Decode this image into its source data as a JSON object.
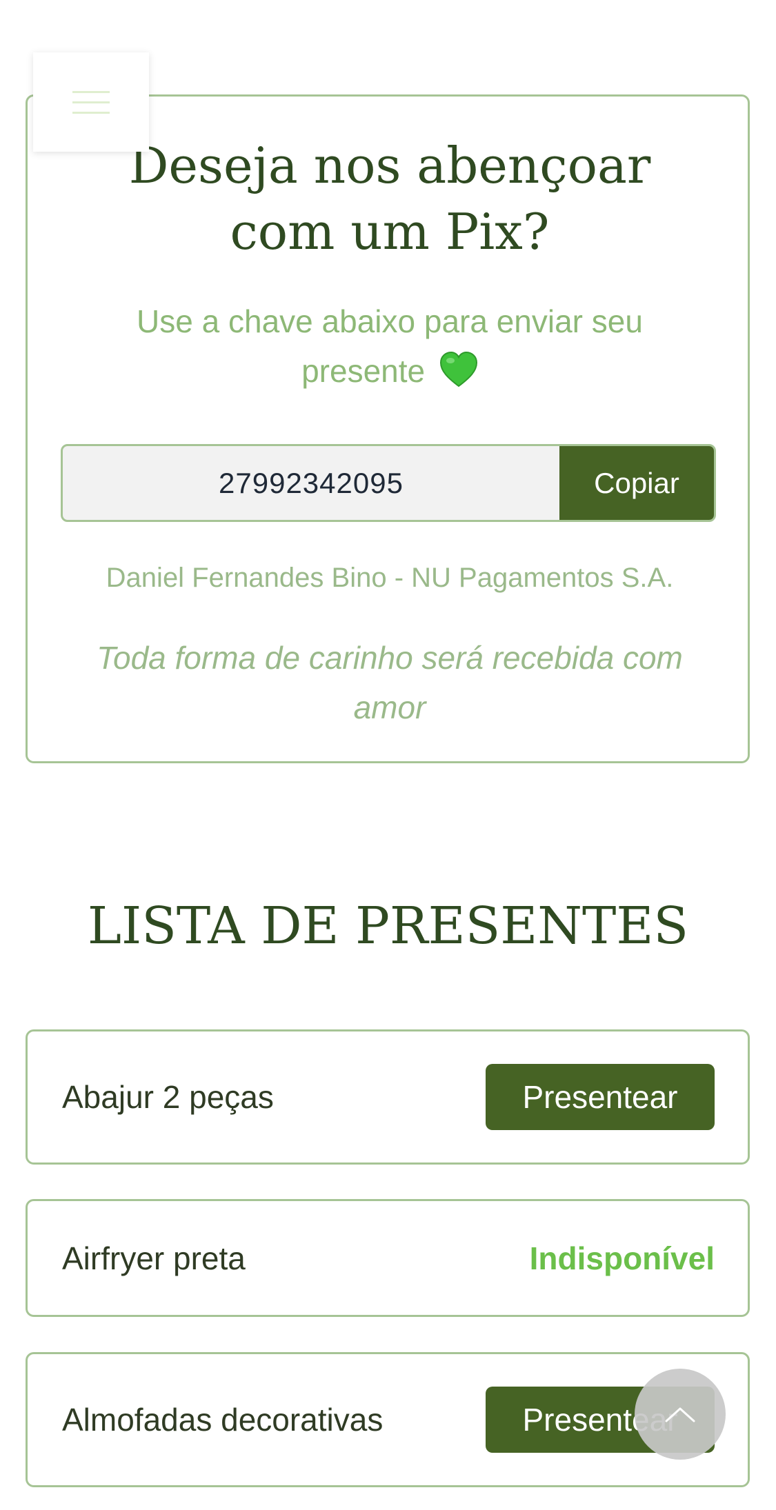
{
  "menu": {
    "icon": "hamburger-icon"
  },
  "pix": {
    "title": "Deseja nos abençoar com um Pix?",
    "subtitle": "Use a chave abaixo para enviar seu presente",
    "subtitle_icon": "green-heart-icon",
    "key_value": "27992342095",
    "copy_label": "Copiar",
    "account_info": "Daniel Fernandes Bino - NU Pagamentos S.A.",
    "note": "Toda forma de carinho será recebida com amor"
  },
  "gifts": {
    "title": "LISTA DE PRESENTES",
    "items": [
      {
        "name": "Abajur 2 peças",
        "action_label": "Presentear"
      },
      {
        "name": "Airfryer preta",
        "status_label": "Indisponível"
      },
      {
        "name": "Almofadas decorativas",
        "action_label": "Presentear"
      }
    ]
  },
  "scroll_top": {
    "icon": "chevron-up-icon"
  },
  "colors": {
    "primary_dark": "#466324",
    "heading": "#2f4a21",
    "accent_light": "#a6c495",
    "muted_text": "#9ab98a",
    "unavailable": "#6bbf4a"
  }
}
